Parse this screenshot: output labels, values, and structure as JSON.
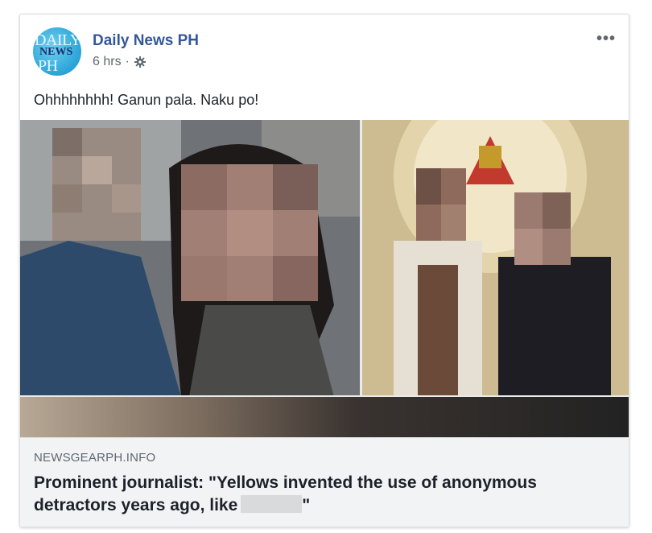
{
  "post": {
    "page_name": "Daily News PH",
    "timestamp": "6 hrs",
    "separator": "·",
    "more_label": "•••",
    "text": "Ohhhhhhhh! Ganun pala. Naku po!"
  },
  "avatar": {
    "line1": "DAILY",
    "line2": "NEWS",
    "line3": "PH"
  },
  "link": {
    "domain": "NEWSGEARPH.INFO",
    "headline_part1": "Prominent journalist: \"Yellows invented the use of anonymous detractors years ago, like",
    "headline_end": "\""
  },
  "colors": {
    "brand_link": "#365899",
    "meta_gray": "#616770",
    "link_bg": "#f2f3f5"
  },
  "icons": {
    "privacy": "gear-icon",
    "menu": "more-options-icon"
  }
}
